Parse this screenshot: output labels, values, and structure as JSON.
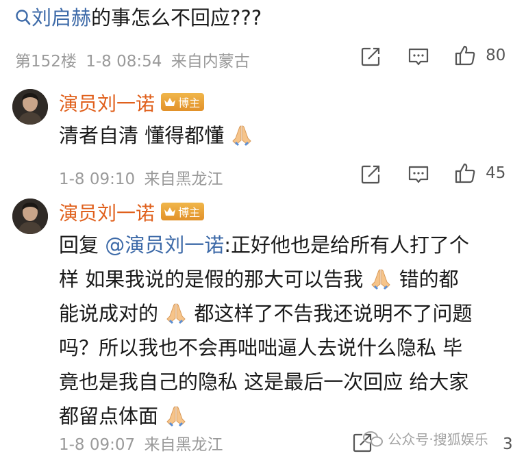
{
  "top_comment": {
    "mention": "刘启赫",
    "text_after": "的事怎么不回应???",
    "floor": "第152楼",
    "time": "1-8 08:54",
    "location": "来自内蒙古",
    "likes": "80"
  },
  "replies": [
    {
      "username": "演员刘一诺",
      "badge": "博主",
      "text": "清者自清 懂得都懂",
      "time": "1-8 09:10",
      "location": "来自黑龙江",
      "likes": "45"
    },
    {
      "username": "演员刘一诺",
      "badge": "博主",
      "reply_prefix": "回复",
      "reply_mention": "@演员刘一诺",
      "lines": [
        ":正好他也是给所有人打了个",
        "样 如果我说的是假的那大可以告我",
        "错的都",
        "能说成对的",
        "都这样了不告我还说明不了问题",
        "吗？所以我也不会再咄咄逼人去说什么隐私 毕",
        "竟也是我自己的隐私 这是最后一次回应 给大家",
        "都留点体面"
      ],
      "time": "1-8 09:07",
      "location": "来自黑龙江",
      "likes": "3"
    }
  ],
  "watermark": {
    "prefix": "公众号",
    "separator": "·",
    "name": "搜狐娱乐"
  },
  "colors": {
    "link": "#3d6aa8",
    "username": "#e0601c",
    "meta": "#9a9a9a",
    "badge": "#e9a23a"
  },
  "icons": [
    "search-icon",
    "repost-icon",
    "comment-icon",
    "like-icon",
    "praying-hands-emoji",
    "crown-icon"
  ]
}
